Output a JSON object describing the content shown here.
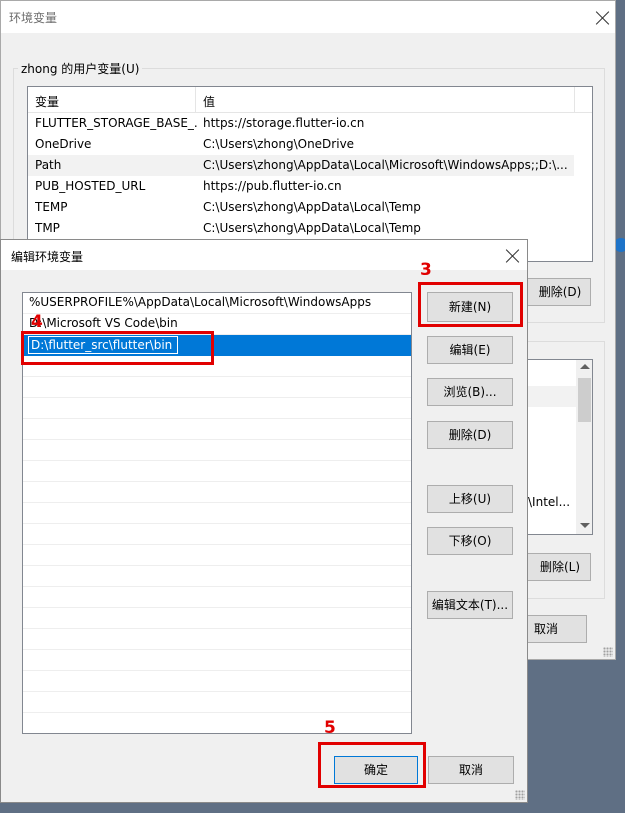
{
  "parent_dialog": {
    "title": "环境变量",
    "user_group_label": "zhong 的用户变量(U)",
    "columns": [
      "变量",
      "值"
    ],
    "rows": [
      {
        "name": "FLUTTER_STORAGE_BASE_...",
        "value": "https://storage.flutter-io.cn"
      },
      {
        "name": "OneDrive",
        "value": "C:\\Users\\zhong\\OneDrive"
      },
      {
        "name": "Path",
        "value": "C:\\Users\\zhong\\AppData\\Local\\Microsoft\\WindowsApps;;D:\\..."
      },
      {
        "name": "PUB_HOSTED_URL",
        "value": "https://pub.flutter-io.cn"
      },
      {
        "name": "TEMP",
        "value": "C:\\Users\\zhong\\AppData\\Local\\Temp"
      },
      {
        "name": "TMP",
        "value": "C:\\Users\\zhong\\AppData\\Local\\Temp"
      }
    ],
    "user_delete_label": "删除(D)",
    "system_value_fragment": "\\Intel...",
    "system_delete_label": "删除(L)",
    "cancel_label": "取消"
  },
  "edit_dialog": {
    "title": "编辑环境变量",
    "paths": [
      "%USERPROFILE%\\AppData\\Local\\Microsoft\\WindowsApps",
      "D:\\Microsoft VS Code\\bin",
      "D:\\flutter_src\\flutter\\bin"
    ],
    "buttons": {
      "new": "新建(N)",
      "edit": "编辑(E)",
      "browse": "浏览(B)...",
      "delete": "删除(D)",
      "move_up": "上移(U)",
      "move_down": "下移(O)",
      "edit_text": "编辑文本(T)...",
      "ok": "确定",
      "cancel": "取消"
    }
  },
  "annotations": {
    "step3": "3",
    "step4": "4",
    "step5": "5"
  },
  "colors": {
    "highlight": "#e10000",
    "selection": "#0078d7",
    "desktop": "#5f6f84"
  }
}
